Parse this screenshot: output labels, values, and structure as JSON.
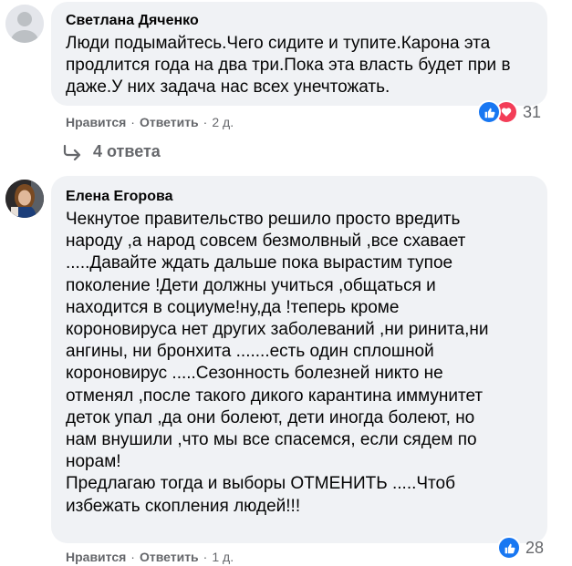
{
  "comments": [
    {
      "author": "Светлана Дяченко",
      "lines": [
        "Люди подымайтесь.Чего сидите и тупите.Карона эта",
        "продлится года на два три.Пока эта власть будет при в",
        "даже.У них задача нас всех унечтожать."
      ],
      "like_label": "Нравится",
      "reply_label": "Ответить",
      "time": "2 д.",
      "reaction_count": "31",
      "reaction_icons": [
        "like-icon",
        "love-icon"
      ],
      "replies_label": "4 ответа"
    },
    {
      "author": "Елена Егорова",
      "lines": [
        "Чекнутое правительство решило просто вредить",
        "народу ,а народ совсем безмолвный ,все схавает",
        ".....Давайте ждать дальше пока вырастим тупое",
        "поколение !Дети должны учиться ,общаться и",
        "находится в социуме!ну,да !теперь кроме",
        "короновируса нет других заболеваний ,ни ринита,ни",
        "ангины, ни бронхита .......есть один сплошной",
        "короновирус .....Сезонность болезней никто не",
        "отменял ,после такого дикого карантина иммунитет",
        "деток упал ,да они болеют, дети иногда болеют, но",
        "нам внушили ,что мы все спасемся, если сядем по",
        "норам!",
        "Предлагаю тогда и выборы ОТМЕНИТЬ .....Чтоб",
        "избежать скопления людей!!!"
      ],
      "like_label": "Нравится",
      "reply_label": "Ответить",
      "time": "1 д.",
      "reaction_count": "28",
      "reaction_icons": [
        "like-icon"
      ]
    }
  ],
  "colors": {
    "bubble": "#f0f2f5",
    "meta_text": "#65676b",
    "like_blue": "#1877f2",
    "love_red": "#f33e58"
  }
}
